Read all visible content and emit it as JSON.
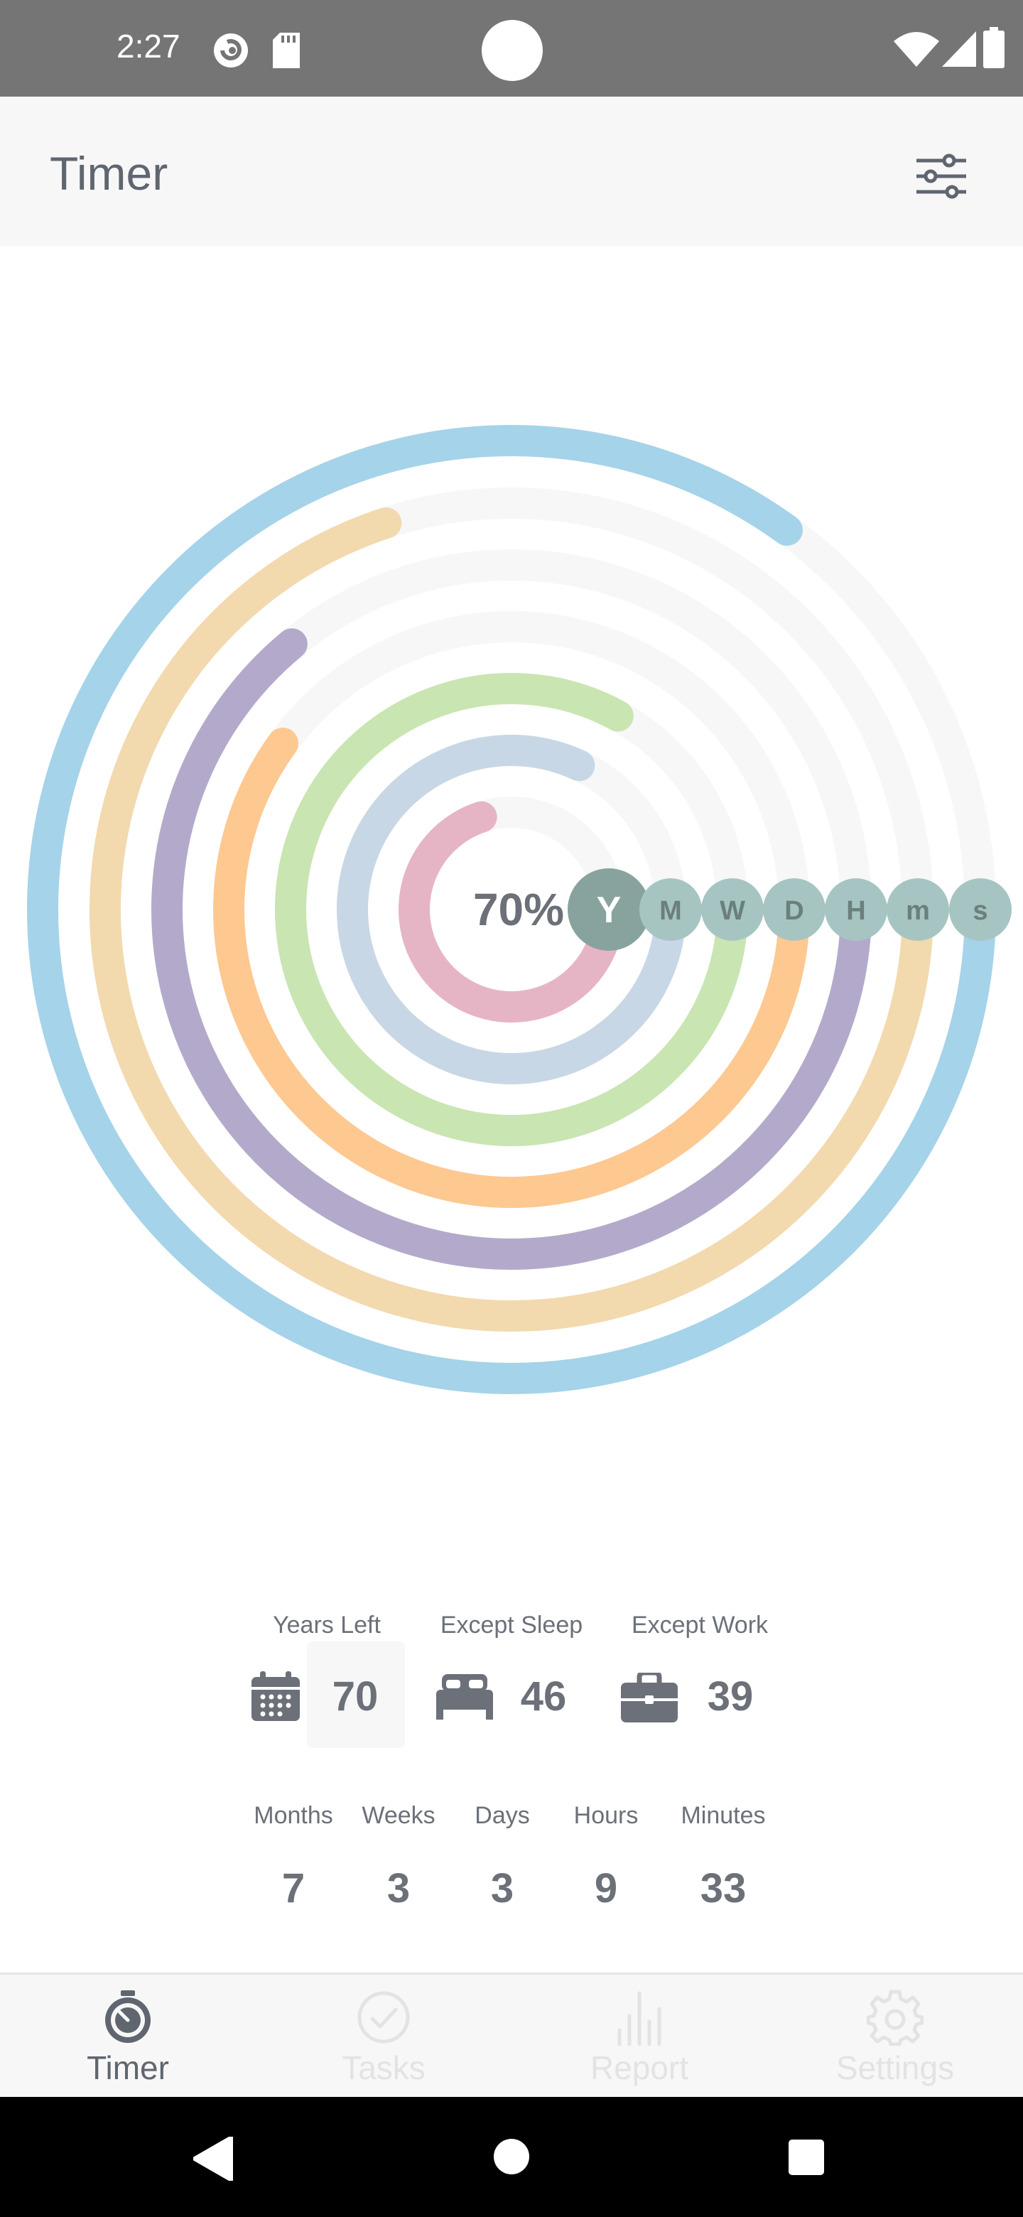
{
  "status_bar": {
    "time": "2:27",
    "icons": [
      "pocket-casts-icon",
      "sd-card-icon",
      "wifi-icon",
      "signal-icon",
      "battery-icon"
    ]
  },
  "app_bar": {
    "title": "Timer",
    "filter_icon": "sliders-icon"
  },
  "rings": {
    "center_label": "70%",
    "unit_labels": [
      "Y",
      "M",
      "W",
      "D",
      "H",
      "m",
      "s"
    ],
    "rings": [
      {
        "unit": "s",
        "progress": 0.85,
        "color": "#a5d3e9"
      },
      {
        "unit": "m",
        "progress": 0.7,
        "color": "#f2d9ae"
      },
      {
        "unit": "H",
        "progress": 0.64,
        "color": "#b3aacb"
      },
      {
        "unit": "D",
        "progress": 0.6,
        "color": "#fec891"
      },
      {
        "unit": "W",
        "progress": 0.83,
        "color": "#c9e5b2"
      },
      {
        "unit": "M",
        "progress": 0.82,
        "color": "#c8d7e6"
      },
      {
        "unit": "Y",
        "progress": 0.7,
        "color": "#e6b5c5"
      }
    ],
    "track_color": "#f7f7f7",
    "active_badge_color": "#88a39e",
    "badge_color": "#a6c5c2"
  },
  "summary": {
    "years_left": {
      "label": "Years Left",
      "value": "70",
      "icon": "calendar-icon"
    },
    "except_sleep": {
      "label": "Except Sleep",
      "value": "46",
      "icon": "bed-icon"
    },
    "except_work": {
      "label": "Except Work",
      "value": "39",
      "icon": "briefcase-icon"
    }
  },
  "breakdown": [
    {
      "label": "Months",
      "value": "7"
    },
    {
      "label": "Weeks",
      "value": "3"
    },
    {
      "label": "Days",
      "value": "3"
    },
    {
      "label": "Hours",
      "value": "9"
    },
    {
      "label": "Minutes",
      "value": "33"
    }
  ],
  "bottom_nav": [
    {
      "label": "Timer",
      "icon": "timer-icon",
      "active": true
    },
    {
      "label": "Tasks",
      "icon": "check-circle-icon",
      "active": false
    },
    {
      "label": "Report",
      "icon": "bar-chart-icon",
      "active": false
    },
    {
      "label": "Settings",
      "icon": "gear-icon",
      "active": false
    }
  ],
  "colors": {
    "active_nav": "#5f6670",
    "inactive_nav": "#e3e3e3"
  }
}
